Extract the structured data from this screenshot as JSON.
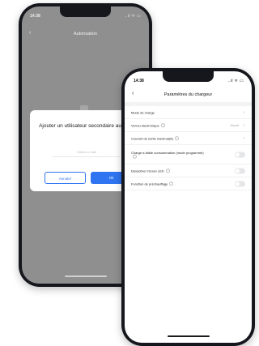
{
  "back_phone": {
    "status": {
      "time": "14:38",
      "icons": "..ıl ᯤ ▭"
    },
    "nav": {
      "back": "‹",
      "title": "Autorisation"
    },
    "dialog": {
      "title": "Ajouter un utilisateur secondaire autorisé",
      "input_placeholder": "Entrez e-mail",
      "cancel_label": "Annuler",
      "ok_label": "Ok"
    }
  },
  "front_phone": {
    "status": {
      "time": "14:38",
      "icons": "..ıl ᯤ ▭"
    },
    "nav": {
      "back": "‹",
      "title": "Paramètres du chargeur"
    },
    "rows": [
      {
        "label": "Mode de charge",
        "control": "chevron"
      },
      {
        "label": "Verrou électronique",
        "value": "Ouvert",
        "control": "chevron"
      },
      {
        "label": "Courant de sortie maximal(A)",
        "control": "chevron"
      },
      {
        "label": "Charge à faible consommation (mode programmé)",
        "control": "toggle",
        "on": false
      },
      {
        "label": "Désactiver l'écran LED",
        "control": "toggle",
        "on": false
      },
      {
        "label": "Fonction de préchauffage",
        "control": "toggle",
        "on": false
      }
    ]
  },
  "colors": {
    "accent": "#2f74f0",
    "overlay": "#8f8f8f",
    "frame": "#15171c"
  }
}
